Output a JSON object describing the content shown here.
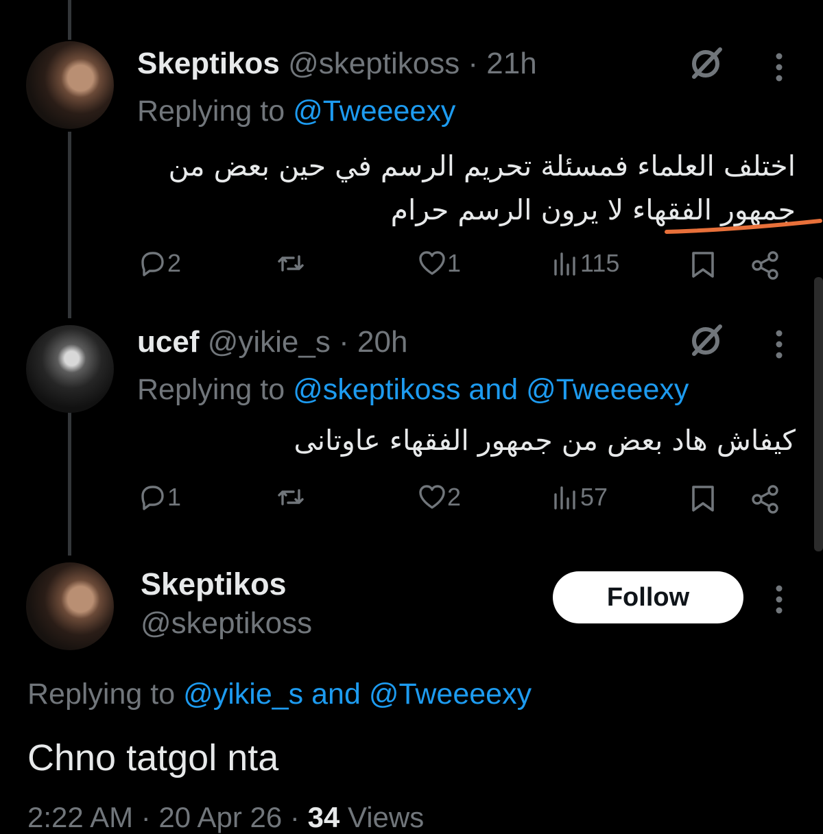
{
  "reply1": {
    "display_name": "Skeptikos",
    "handle": "@skeptikoss",
    "time": "· 21h",
    "replying_prefix": "Replying to",
    "replying_to": "@Tweeeexy",
    "text_line1": "اختلف العلماء فمسئلة تحريم الرسم في حين بعض من",
    "text_line2": "جمهور الفقهاء لا يرون الرسم حرام",
    "stats": {
      "replies": "2",
      "likes": "1",
      "views": "115"
    }
  },
  "reply2": {
    "display_name": "ucef",
    "handle": "@yikie_s",
    "time": "· 20h",
    "replying_prefix": "Replying to",
    "replying_to": "@skeptikoss and @Tweeeexy",
    "text": "كيفاش هاد بعض من جمهور الفقهاء عاوتانى",
    "stats": {
      "replies": "1",
      "likes": "2",
      "views": "57"
    }
  },
  "main_tweet": {
    "display_name": "Skeptikos",
    "handle": "@skeptikoss",
    "follow_label": "Follow",
    "replying_prefix": "Replying to",
    "replying_to": "@yikie_s and @Tweeeexy",
    "text": "Chno tatgol nta",
    "meta_time": "2:22 AM · 20 Apr 26 ·",
    "views_count": "34",
    "views_label": "Views"
  },
  "colors": {
    "background": "#000000",
    "text": "#e7e9ea",
    "muted": "#71767b",
    "link": "#1d9bf0",
    "underline": "#e8703a"
  },
  "icons": [
    "grok-icon",
    "more-icon",
    "reply-icon",
    "retweet-icon",
    "like-icon",
    "views-icon",
    "bookmark-icon",
    "share-icon"
  ]
}
